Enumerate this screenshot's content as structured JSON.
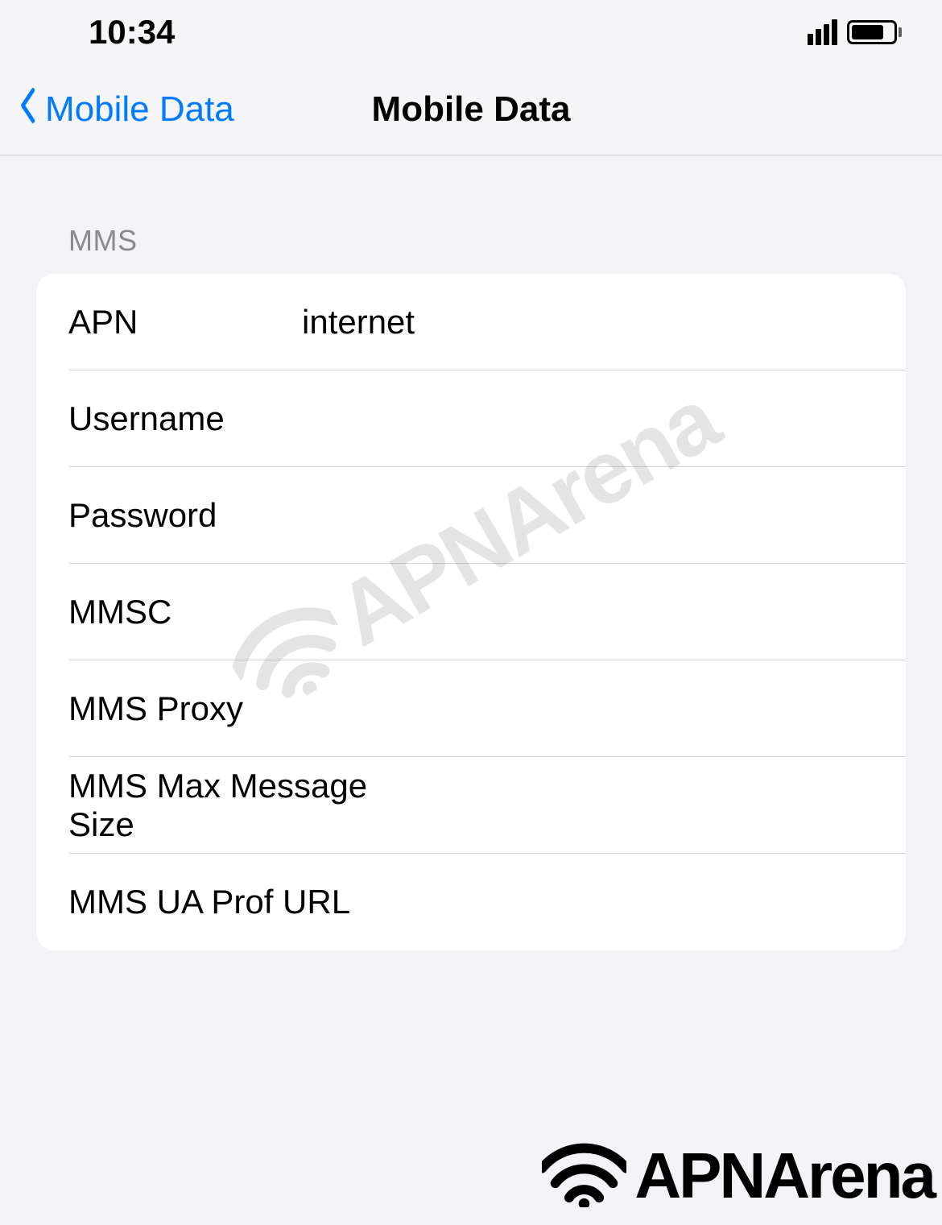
{
  "status": {
    "time": "10:34"
  },
  "nav": {
    "back_label": "Mobile Data",
    "title": "Mobile Data"
  },
  "section": {
    "header": "MMS",
    "fields": {
      "apn": {
        "label": "APN",
        "value": "internet"
      },
      "username": {
        "label": "Username",
        "value": ""
      },
      "password": {
        "label": "Password",
        "value": ""
      },
      "mmsc": {
        "label": "MMSC",
        "value": ""
      },
      "mms_proxy": {
        "label": "MMS Proxy",
        "value": ""
      },
      "mms_max_size": {
        "label": "MMS Max Message Size",
        "value": ""
      },
      "mms_ua_prof": {
        "label": "MMS UA Prof URL",
        "value": ""
      }
    }
  },
  "watermark": {
    "text": "APNArena"
  }
}
